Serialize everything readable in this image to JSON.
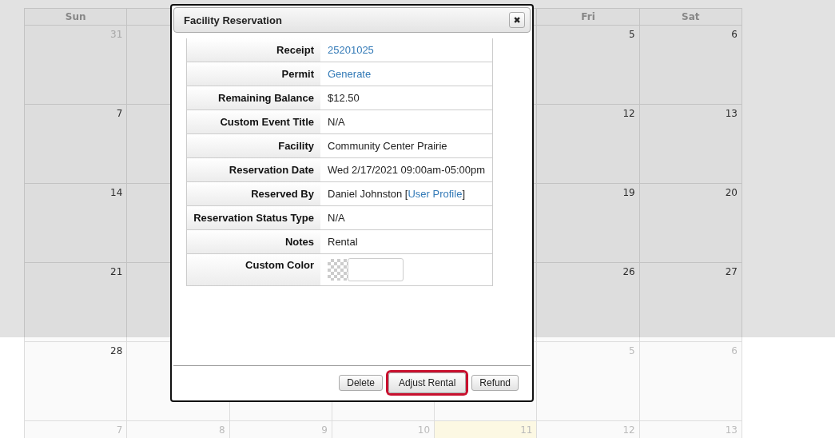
{
  "calendar": {
    "headers": {
      "from_start": [
        "Sun"
      ],
      "from_end": [
        "Fri",
        "Sat"
      ]
    },
    "weeks": [
      {
        "from_start": [
          {
            "day": "31",
            "other_month": true
          }
        ],
        "from_end": [
          {
            "day": "5",
            "other_month": false
          },
          {
            "day": "6",
            "other_month": false
          }
        ]
      },
      {
        "from_start": [
          {
            "day": "7",
            "other_month": false
          }
        ],
        "from_end": [
          {
            "day": "12",
            "other_month": false
          },
          {
            "day": "13",
            "other_month": false
          }
        ]
      },
      {
        "from_start": [
          {
            "day": "14",
            "other_month": false
          }
        ],
        "from_end": [
          {
            "day": "19",
            "other_month": false
          },
          {
            "day": "20",
            "other_month": false
          }
        ]
      },
      {
        "from_start": [
          {
            "day": "21",
            "other_month": false
          }
        ],
        "from_end": [
          {
            "day": "26",
            "other_month": false
          },
          {
            "day": "27",
            "other_month": false
          }
        ]
      },
      {
        "from_start": [
          {
            "day": "28",
            "other_month": false
          }
        ],
        "from_end": [
          {
            "day": "5",
            "other_month": true
          },
          {
            "day": "6",
            "other_month": true
          }
        ]
      },
      {
        "from_start": [
          {
            "day": "7",
            "other_month": true
          },
          {
            "day": "8",
            "other_month": true
          },
          {
            "day": "9",
            "other_month": true
          },
          {
            "day": "10",
            "other_month": true
          },
          {
            "day": "11",
            "other_month": true,
            "today": true
          },
          {
            "day": "12",
            "other_month": true
          },
          {
            "day": "13",
            "other_month": true
          }
        ]
      }
    ]
  },
  "dialog": {
    "title": "Facility Reservation",
    "close": "✖",
    "rows": [
      {
        "kind": "link",
        "label": "Receipt",
        "value": "25201025"
      },
      {
        "kind": "link",
        "label": "Permit",
        "value": "Generate"
      },
      {
        "kind": "text",
        "label": "Remaining Balance",
        "value": "$12.50"
      },
      {
        "kind": "text",
        "label": "Custom Event Title",
        "value": "N/A"
      },
      {
        "kind": "text",
        "label": "Facility",
        "value": "Community Center Prairie"
      },
      {
        "kind": "text",
        "label": "Reservation Date",
        "value": "Wed 2/17/2021 09:00am-05:00pm"
      },
      {
        "kind": "text_with_link",
        "label": "Reserved By",
        "value": "Daniel Johnston [",
        "link": "User Profile",
        "suffix": "]"
      },
      {
        "kind": "text",
        "label": "Reservation Status Type",
        "value": "N/A"
      },
      {
        "kind": "text",
        "label": "Notes",
        "value": "Rental"
      },
      {
        "kind": "color",
        "label": "Custom Color"
      }
    ],
    "buttons": [
      {
        "label": "Delete",
        "highlighted": false
      },
      {
        "label": "Adjust Rental",
        "highlighted": true
      },
      {
        "label": "Refund",
        "highlighted": false
      }
    ]
  }
}
